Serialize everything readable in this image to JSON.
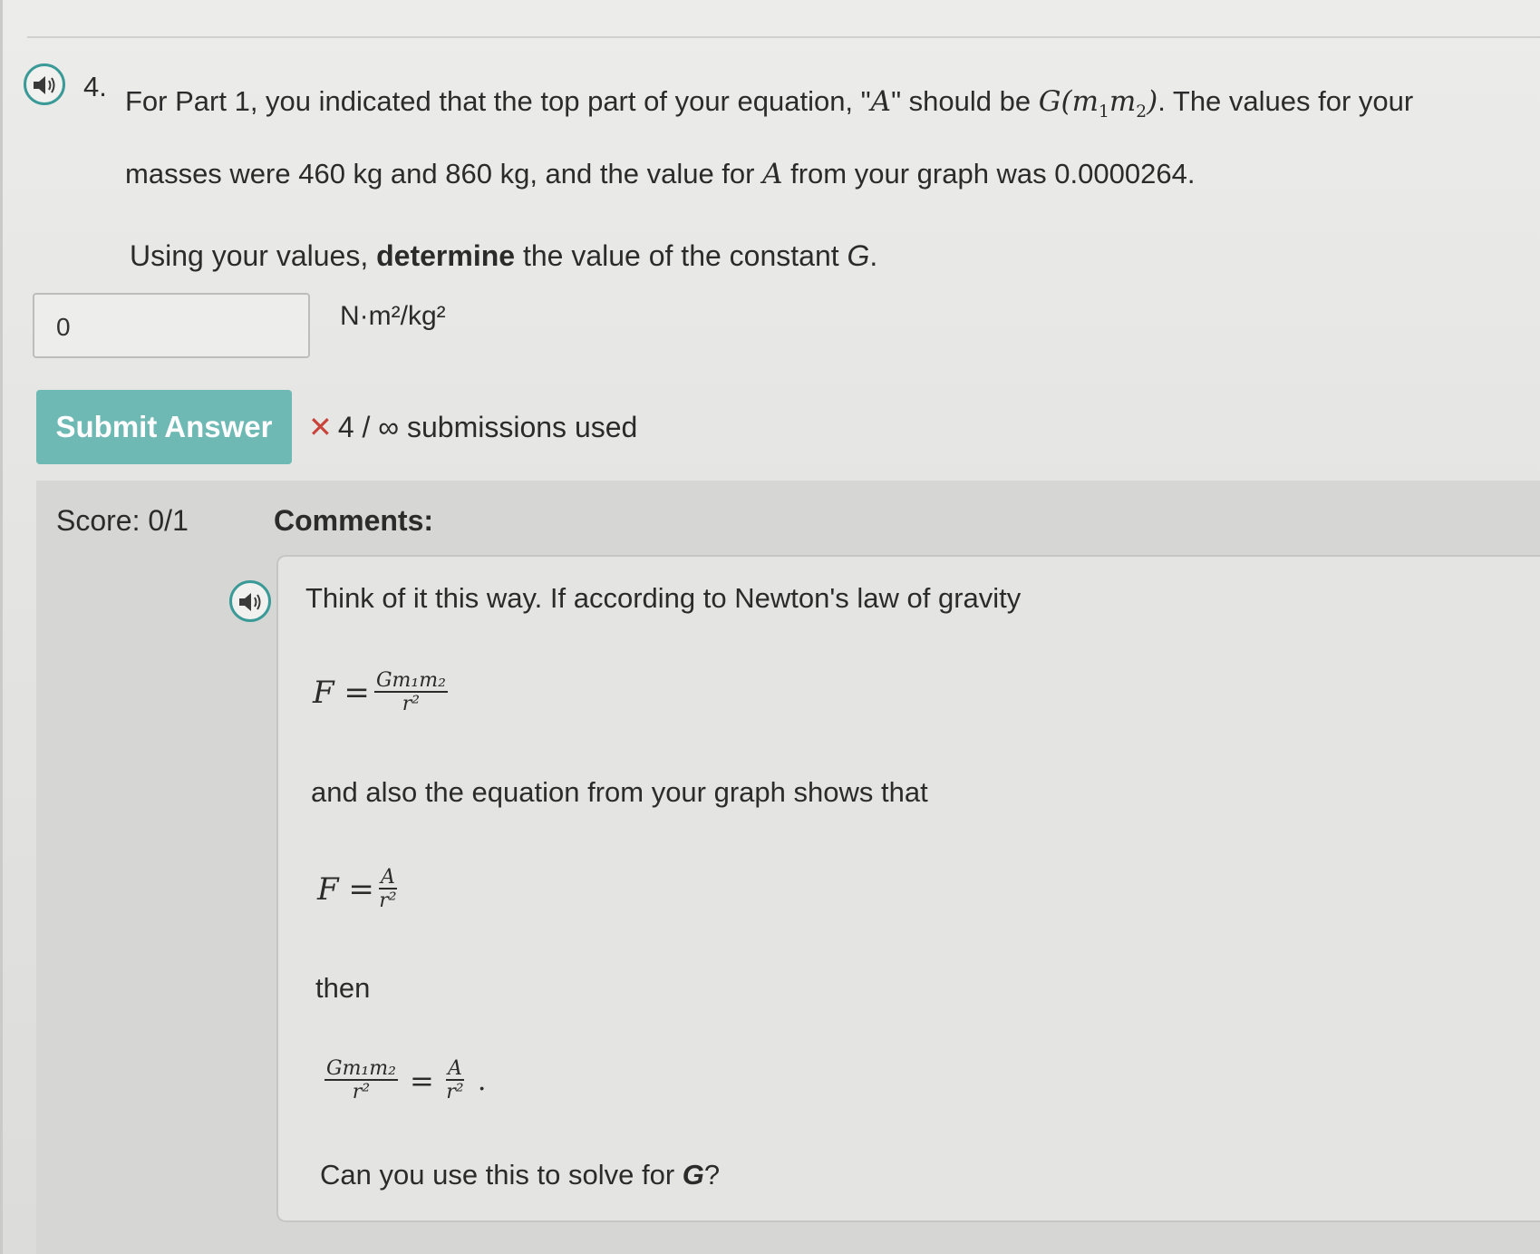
{
  "question": {
    "number": "4.",
    "line1_pre": "For Part 1, you indicated that the top part of your equation, \"",
    "var_A": "A",
    "line1_mid": "\" should be ",
    "expr_G": "G(m",
    "sub1": "1",
    "expr_m2": "m",
    "sub2": "2",
    "expr_close": ")",
    "line1_post": ". The values for your",
    "line2_pre": "masses were 460 kg and 860 kg, and the value for ",
    "line2_post": " from your graph was 0.0000264.",
    "prompt_pre": "Using your values, ",
    "prompt_bold": "determine",
    "prompt_post": " the value of the constant ",
    "prompt_G": "G",
    "prompt_end": "."
  },
  "answer": {
    "value": "0",
    "units": "N·m²/kg²"
  },
  "submit": {
    "label": "Submit Answer",
    "mark": "✕",
    "used_text": "4 / ∞ submissions used"
  },
  "feedback": {
    "score_label": "Score: 0/1",
    "comments_label": "Comments:",
    "line1": "Think of it this way. If according to Newton's law of gravity",
    "eq1_lhs": "F =",
    "eq1_num": "Gm₁m₂",
    "eq1_den": "r²",
    "line2": "and also the equation from your graph shows that",
    "eq2_lhs": "F =",
    "eq2_num": "A",
    "eq2_den": "r²",
    "line3": "then",
    "eq3_num1": "Gm₁m₂",
    "eq3_den1": "r²",
    "eq3_eq": "=",
    "eq3_num2": "A",
    "eq3_den2": "r²",
    "eq3_end": ".",
    "line4_pre": "Can you use this to solve for ",
    "line4_G": "G",
    "line4_end": "?"
  },
  "colors": {
    "accent": "#6fb9b5",
    "speaker_ring": "#3a9a98",
    "error_mark": "#c9433b"
  },
  "icons": [
    "speaker-icon",
    "close-icon"
  ]
}
